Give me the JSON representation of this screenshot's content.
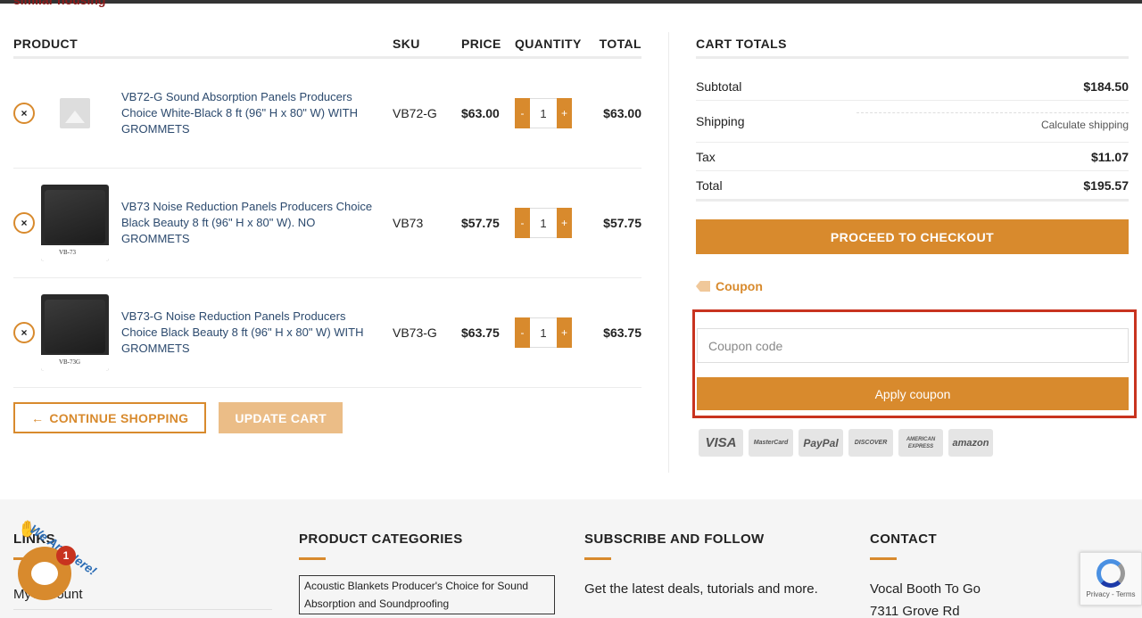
{
  "breadcrumb": "similar housing",
  "cart": {
    "headers": {
      "product": "PRODUCT",
      "sku": "SKU",
      "price": "PRICE",
      "quantity": "QUANTITY",
      "total": "TOTAL"
    },
    "items": [
      {
        "name": "VB72-G Sound Absorption Panels Producers Choice White-Black 8 ft (96\" H x 80\" W) WITH GROMMETS",
        "sku": "VB72-G",
        "price": "$63.00",
        "qty": "1",
        "total": "$63.00",
        "thumb": "placeholder-image-icon"
      },
      {
        "name": "VB73 Noise Reduction Panels Producers Choice Black Beauty 8 ft (96\" H x 80\" W). NO GROMMETS",
        "sku": "VB73",
        "price": "$57.75",
        "qty": "1",
        "total": "$57.75",
        "thumb_label": "VB-73"
      },
      {
        "name": "VB73-G Noise Reduction Panels Producers Choice Black Beauty 8 ft (96\" H x 80\" W) WITH GROMMETS",
        "sku": "VB73-G",
        "price": "$63.75",
        "qty": "1",
        "total": "$63.75",
        "thumb_label": "VB-73G"
      }
    ],
    "remove_symbol": "×",
    "minus": "-",
    "plus": "+",
    "continue_shopping": "CONTINUE SHOPPING",
    "continue_arrow": "←",
    "update_cart": "UPDATE CART"
  },
  "totals": {
    "title": "CART TOTALS",
    "subtotal_label": "Subtotal",
    "subtotal": "$184.50",
    "shipping_label": "Shipping",
    "shipping": "Calculate shipping",
    "tax_label": "Tax",
    "tax": "$11.07",
    "total_label": "Total",
    "total": "$195.57",
    "checkout": "PROCEED TO CHECKOUT",
    "coupon_title": "Coupon",
    "coupon_placeholder": "Coupon code",
    "apply": "Apply coupon",
    "payments": [
      "VISA",
      "MasterCard",
      "PayPal",
      "DISCOVER",
      "AMERICAN EXPRESS",
      "amazon"
    ]
  },
  "footer": {
    "links_title": "LINKS",
    "my_account": "My Account",
    "categories_title": "PRODUCT CATEGORIES",
    "category_1": "Acoustic Blankets Producer's Choice for Sound Absorption and Soundproofing",
    "subscribe_title": "SUBSCRIBE AND FOLLOW",
    "subscribe_text": "Get the latest deals, tutorials and more.",
    "contact_title": "CONTACT",
    "contact_line1": "Vocal Booth To Go",
    "contact_line2": "7311 Grove Rd"
  },
  "chat": {
    "badge": "1",
    "tagline": "We Are Here!"
  },
  "recaptcha": {
    "links": "Privacy - Terms"
  },
  "colors": {
    "accent": "#d88a2d",
    "highlight": "#c8331f",
    "link": "#2c4a6e"
  }
}
